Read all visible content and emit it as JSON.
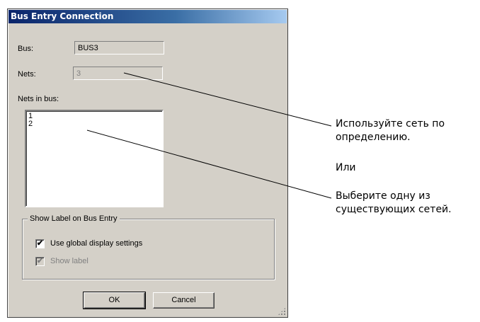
{
  "dialog": {
    "title": "Bus Entry Connection",
    "bus_label": "Bus:",
    "bus_value": "BUS3",
    "nets_label": "Nets:",
    "nets_value": "3",
    "nets_in_bus_label": "Nets in bus:",
    "nets_in_bus_items": [
      "1",
      "2"
    ],
    "group_title": "Show Label on Bus Entry",
    "use_global_label": "Use global display settings",
    "use_global_checked": true,
    "show_label_label": "Show label",
    "show_label_checked": true,
    "ok_label": "OK",
    "cancel_label": "Cancel"
  },
  "annotations": {
    "note1_line1": "Используйте сеть по",
    "note1_line2": "определению.",
    "or_text": "Или",
    "note2_line1": "Выберите одну из",
    "note2_line2": "существующих сетей."
  }
}
